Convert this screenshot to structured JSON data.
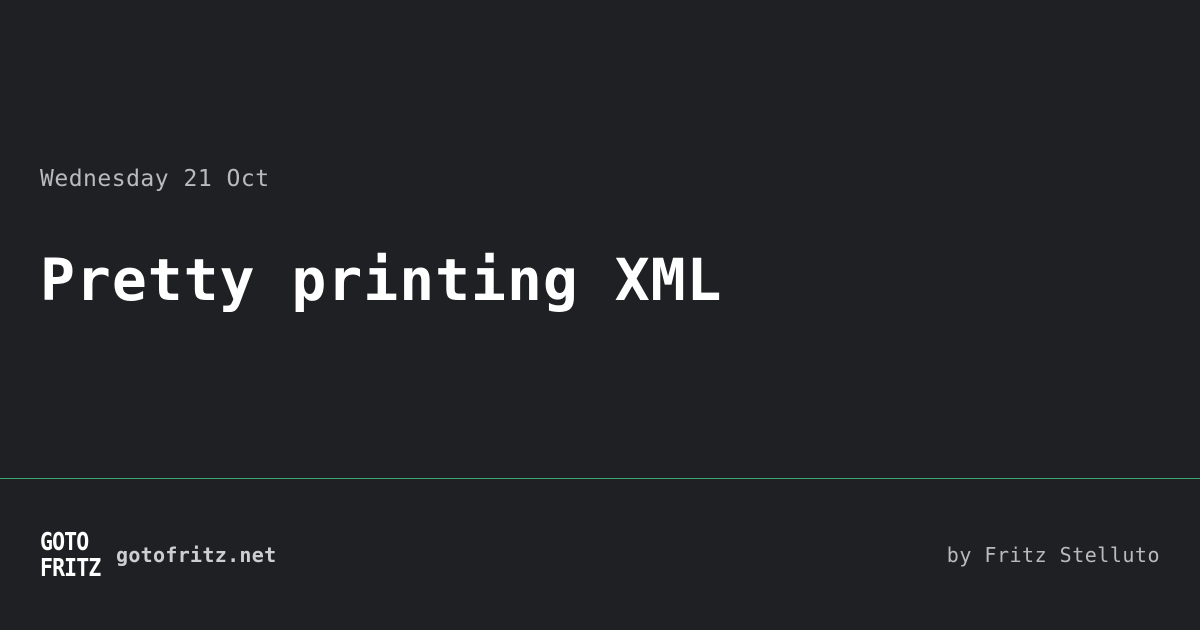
{
  "post": {
    "date": "Wednesday 21 Oct",
    "title": "Pretty printing XML"
  },
  "footer": {
    "logo_line_1": "GOTO",
    "logo_line_2": "FRITZ",
    "site": "gotofritz.net",
    "byline": "by Fritz Stelluto"
  },
  "colors": {
    "background": "#1f2023",
    "divider": "#3fa372",
    "title": "#ffffff",
    "muted_text": "#b9babd"
  }
}
